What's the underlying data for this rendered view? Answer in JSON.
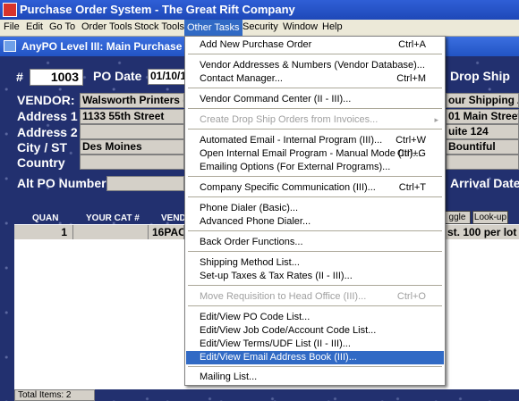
{
  "app": {
    "title": "Purchase Order System - The Great Rift Company"
  },
  "menubar": [
    "File",
    "Edit",
    "Go To",
    "Order Tools",
    "Stock Tools",
    "Other Tasks",
    "Security",
    "Window",
    "Help"
  ],
  "child_window": {
    "title": "AnyPO Level III: Main Purchase O"
  },
  "po": {
    "number_label": "#",
    "number": "1003",
    "date_label": "PO Date",
    "date_value": "01/10/1",
    "drop_ship_label": "Drop Ship"
  },
  "vendor": {
    "vendor_label": "VENDOR:",
    "address1_label": "Address 1",
    "address2_label": "Address 2",
    "city_label": "City / ST",
    "country_label": "Country",
    "name": "Walsworth Printers (",
    "address1": "1133 55th Street",
    "address2": "",
    "city": "Des Moines",
    "country": ""
  },
  "drop_ship": {
    "name": "our Shipping A",
    "address1": "01 Main Street",
    "address2": "uite 124",
    "city": "Bountiful"
  },
  "alt_po_label": "Alt PO Number",
  "arrival_label": "Arrival Date",
  "grid": {
    "headers": [
      "QUAN",
      "YOUR CAT #",
      "VEND"
    ],
    "row": {
      "quan": "1",
      "cat": "",
      "vend": "16PAC",
      "desc": "st.  100 per lot"
    },
    "toggle_label": "ggle",
    "lookup_label": "Look-up"
  },
  "status": {
    "total_items": "Total Items: 2"
  },
  "dropdown": {
    "items": [
      {
        "label": "Add New Purchase Order",
        "shortcut": "Ctrl+A",
        "disabled": false
      },
      {
        "label": "Vendor Addresses & Numbers (Vendor Database)...",
        "shortcut": "",
        "disabled": false
      },
      {
        "label": "Contact Manager...",
        "shortcut": "Ctrl+M",
        "disabled": false
      },
      {
        "label": "Vendor Command Center (II - III)...",
        "shortcut": "",
        "disabled": false
      },
      {
        "label": "Create Drop Ship Orders from Invoices...",
        "shortcut": "",
        "disabled": true
      },
      {
        "label": "Automated Email - Internal Program (III)...",
        "shortcut": "Ctrl+W",
        "disabled": false
      },
      {
        "label": "Open Internal Email Program - Manual Mode (III)...",
        "shortcut": "Ctrl+G",
        "disabled": false
      },
      {
        "label": "Emailing Options (For External Programs)...",
        "shortcut": "",
        "disabled": false
      },
      {
        "label": "Company Specific Communication (III)...",
        "shortcut": "Ctrl+T",
        "disabled": false
      },
      {
        "label": "Phone Dialer (Basic)...",
        "shortcut": "",
        "disabled": false
      },
      {
        "label": "Advanced Phone Dialer...",
        "shortcut": "",
        "disabled": false
      },
      {
        "label": "Back Order Functions...",
        "shortcut": "",
        "disabled": false
      },
      {
        "label": "Shipping Method List...",
        "shortcut": "",
        "disabled": false
      },
      {
        "label": "Set-up Taxes & Tax Rates (II - III)...",
        "shortcut": "",
        "disabled": false
      },
      {
        "label": "Move Requisition to Head Office (III)...",
        "shortcut": "Ctrl+O",
        "disabled": true
      },
      {
        "label": "Edit/View PO Code List...",
        "shortcut": "",
        "disabled": false
      },
      {
        "label": "Edit/View Job Code/Account Code List...",
        "shortcut": "",
        "disabled": false
      },
      {
        "label": "Edit/View Terms/UDF List (II - III)...",
        "shortcut": "",
        "disabled": false
      },
      {
        "label": "Edit/View Email Address Book (III)...",
        "shortcut": "",
        "disabled": false
      },
      {
        "label": "Mailing List...",
        "shortcut": "",
        "disabled": false
      }
    ],
    "submenu_arrow": "▸"
  },
  "colors": {
    "highlight": "#316ac5",
    "menu_bg": "#ece9d8",
    "titlebar": "#1e48b8",
    "background": "#22306f"
  }
}
